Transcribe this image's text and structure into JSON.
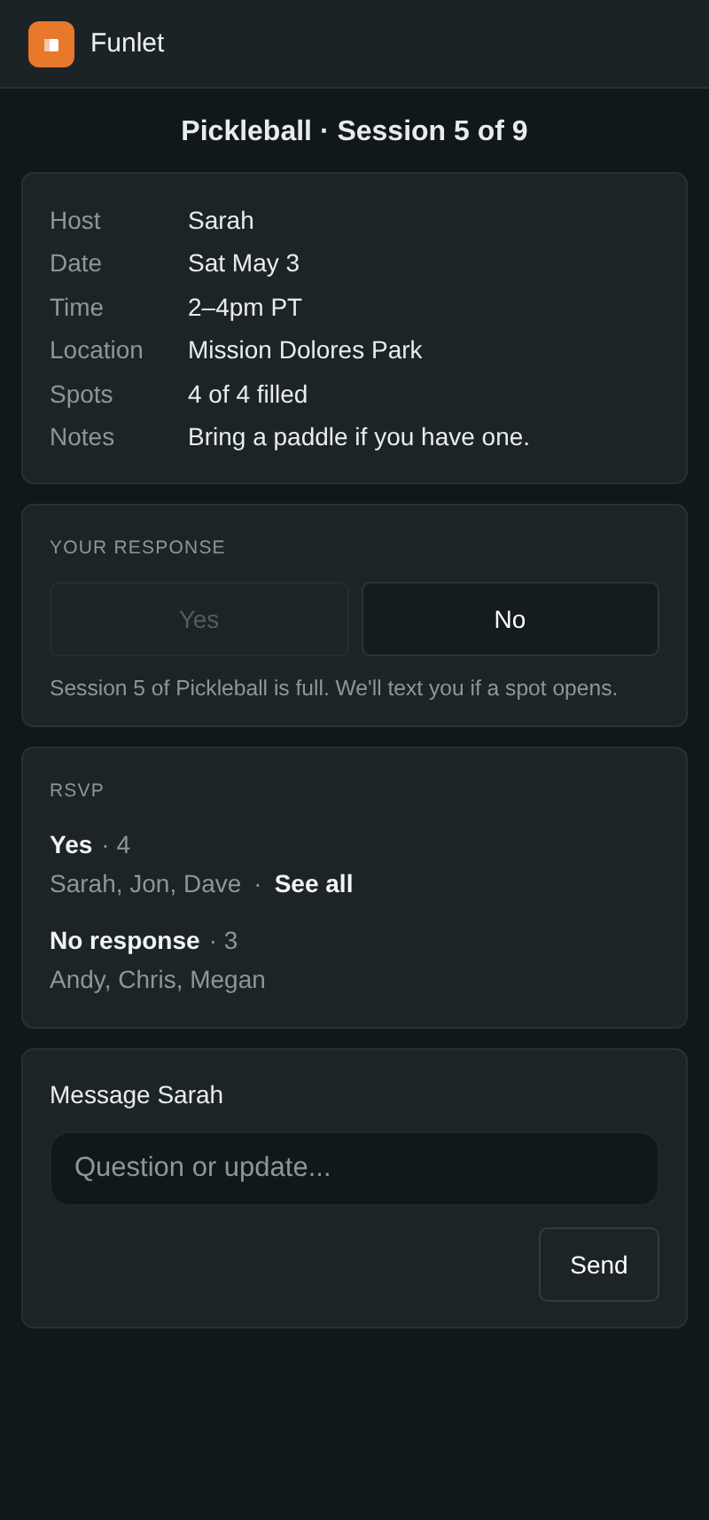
{
  "app": {
    "name": "Funlet"
  },
  "title": "Pickleball · Session 5 of 9",
  "details": [
    {
      "label": "Host",
      "value": "Sarah"
    },
    {
      "label": "Date",
      "value": "Sat May 3"
    },
    {
      "label": "Time",
      "value": "2–4pm PT"
    },
    {
      "label": "Location",
      "value": "Mission Dolores Park"
    },
    {
      "label": "Spots",
      "value": "4 of 4 filled"
    },
    {
      "label": "Notes",
      "value": "Bring a paddle if you have one."
    }
  ],
  "response": {
    "heading": "YOUR RESPONSE",
    "buttons": [
      {
        "label": "Yes",
        "disabled": true
      },
      {
        "label": "No",
        "disabled": false
      }
    ],
    "note": "Session 5 of Pickleball is full. We'll text you if a spot opens."
  },
  "rsvp": {
    "heading": "RSVP",
    "groups": [
      {
        "label": "Yes",
        "count": "· 4",
        "names": "Sarah, Jon, Dave",
        "link_separator": "·",
        "link": "See all"
      },
      {
        "label": "No response",
        "count": "· 3",
        "names": "Andy, Chris, Megan"
      }
    ]
  },
  "message": {
    "heading": "Message Sarah",
    "placeholder": "Question or update...",
    "button": "Send"
  }
}
